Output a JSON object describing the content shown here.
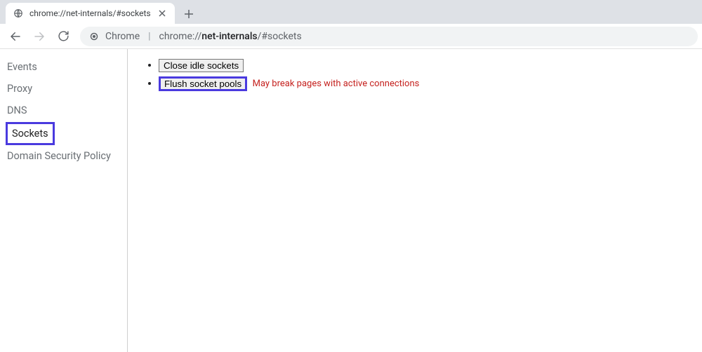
{
  "tab": {
    "title": "chrome://net-internals/#sockets"
  },
  "omnibox": {
    "scheme_host": "Chrome",
    "url_prefix": "chrome://",
    "url_bold": "net-internals",
    "url_suffix": "/#sockets"
  },
  "sidebar": {
    "items": [
      {
        "label": "Events",
        "active": false
      },
      {
        "label": "Proxy",
        "active": false
      },
      {
        "label": "DNS",
        "active": false
      },
      {
        "label": "Sockets",
        "active": true
      },
      {
        "label": "Domain Security Policy",
        "active": false
      }
    ]
  },
  "main": {
    "buttons": {
      "close_idle": "Close idle sockets",
      "flush_pools": "Flush socket pools"
    },
    "warning": "May break pages with active connections"
  }
}
